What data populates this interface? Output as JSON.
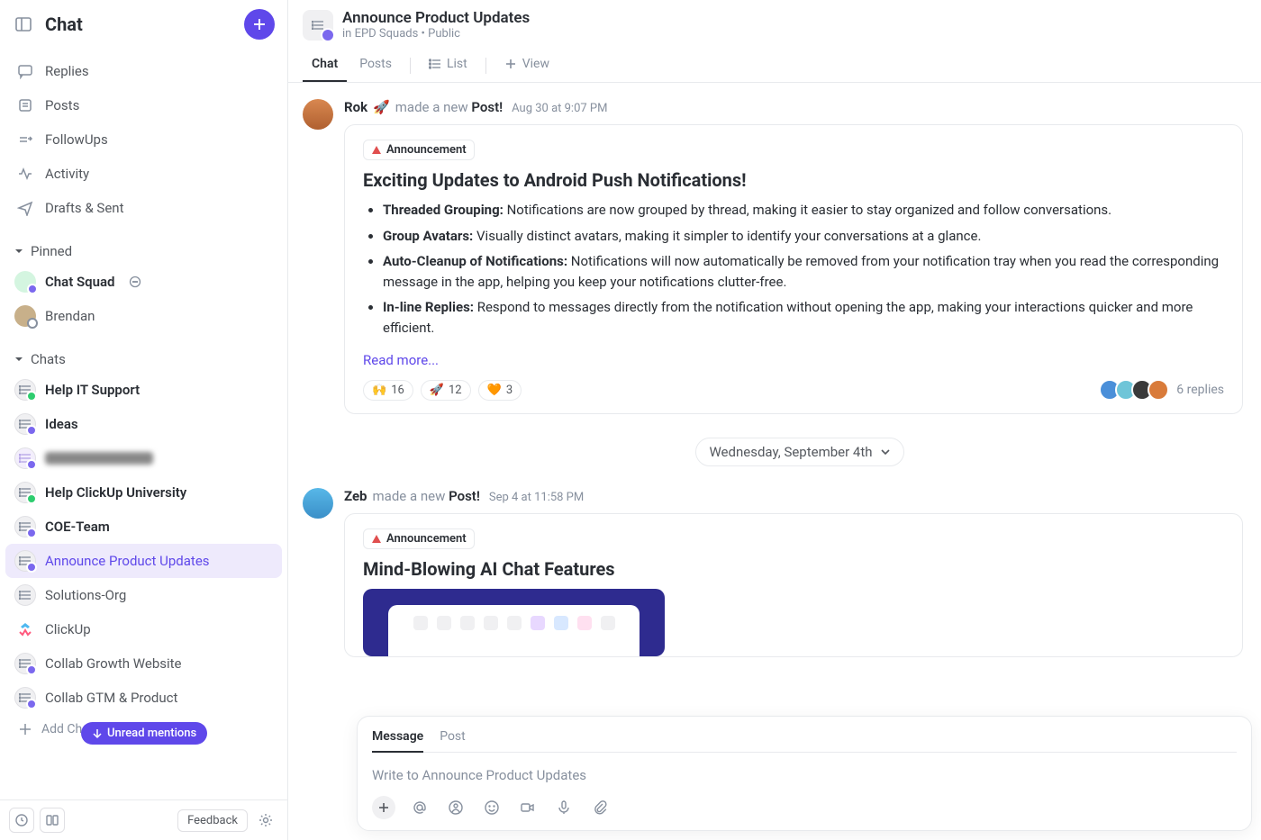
{
  "sidebar": {
    "title": "Chat",
    "nav": [
      {
        "icon": "chat-reply-icon",
        "label": "Replies"
      },
      {
        "icon": "posts-icon",
        "label": "Posts"
      },
      {
        "icon": "followups-icon",
        "label": "FollowUps"
      },
      {
        "icon": "activity-icon",
        "label": "Activity"
      },
      {
        "icon": "drafts-icon",
        "label": "Drafts & Sent"
      }
    ],
    "pinned_label": "Pinned",
    "pinned": [
      {
        "label": "Chat Squad",
        "color": "#2ecd6f",
        "trailing_icon": true
      },
      {
        "label": "Brendan",
        "avatar_color": "#c8b08a"
      }
    ],
    "chats_label": "Chats",
    "chats": [
      {
        "label": "Help IT Support",
        "bold": true,
        "badge": "green"
      },
      {
        "label": "Ideas",
        "bold": true,
        "badge": "purple"
      },
      {
        "label": "         ",
        "bold": true,
        "badge": "purple",
        "blurred": true
      },
      {
        "label": "Help ClickUp University",
        "bold": true,
        "badge": "green"
      },
      {
        "label": "COE-Team",
        "bold": true,
        "badge": "purple"
      },
      {
        "label": "Announce Product Updates",
        "bold": false,
        "badge": "purple",
        "active": true
      },
      {
        "label": "Solutions-Org",
        "bold": false,
        "badge": null
      },
      {
        "label": "ClickUp",
        "bold": false,
        "badge": null,
        "logo": true
      },
      {
        "label": "Collab Growth Website",
        "bold": false,
        "badge": "purple"
      },
      {
        "label": "Collab GTM & Product",
        "bold": false,
        "badge": "purple"
      }
    ],
    "add_chat_label": "Add Chat",
    "unread_pill": "Unread mentions",
    "footer": {
      "feedback": "Feedback"
    }
  },
  "header": {
    "title": "Announce Product Updates",
    "sub_prefix": "in ",
    "sub_space": "EPD Squads",
    "sub_sep": " • ",
    "sub_visibility": "Public",
    "tabs": [
      "Chat",
      "Posts"
    ],
    "views": [
      {
        "icon": "list",
        "label": "List"
      },
      {
        "icon": "plus",
        "label": "View"
      }
    ]
  },
  "feed": {
    "post1": {
      "author": "Rok",
      "emoji": "🚀",
      "action_pre": "made a new ",
      "action_strong": "Post!",
      "time": "Aug 30 at 9:07 PM",
      "chip": "Announcement",
      "title": "Exciting Updates to Android Push Notifications!",
      "bullets": [
        {
          "b": "Threaded Grouping:",
          "t": " Notifications are now grouped by thread, making it easier to stay organized and follow conversations."
        },
        {
          "b": "Group Avatars:",
          "t": " Visually distinct avatars, making it simpler to identify your conversations at a glance."
        },
        {
          "b": "Auto-Cleanup of Notifications:",
          "t": " Notifications will now automatically be removed from your notification tray when you read the corresponding message in the app, helping you keep your notifications clutter-free."
        },
        {
          "b": "In-line Replies:",
          "t": " Respond to messages directly from the notification without opening the app, making your interactions quicker and more efficient."
        }
      ],
      "read_more": "Read more...",
      "reactions": [
        {
          "emoji": "🙌",
          "count": "16"
        },
        {
          "emoji": "🚀",
          "count": "12"
        },
        {
          "emoji": "🧡",
          "count": "3"
        }
      ],
      "replies": "6 replies",
      "reply_avatars": [
        "#4a8fd9",
        "#6fc5d8",
        "#3a3a3a",
        "#d97b3a"
      ]
    },
    "date_divider": "Wednesday, September 4th",
    "post2": {
      "author": "Zeb",
      "action_pre": "made a new ",
      "action_strong": "Post!",
      "time": "Sep 4 at 11:58 PM",
      "chip": "Announcement",
      "title": "Mind-Blowing AI Chat Features"
    }
  },
  "composer": {
    "tabs": [
      "Message",
      "Post"
    ],
    "placeholder": "Write to Announce Product Updates"
  }
}
